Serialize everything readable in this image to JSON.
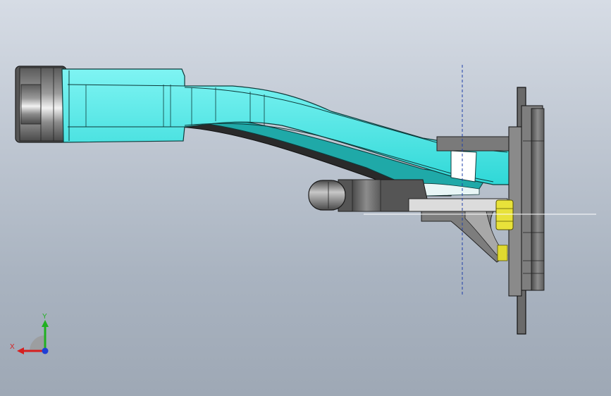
{
  "viewport": {
    "background_top": "#d6dce5",
    "background_bottom": "#9ea8b5"
  },
  "model": {
    "arm_color": "#2fe0df",
    "arm_dark": "#1a8f8e",
    "housing_color": "#6e6e6e",
    "housing_dark": "#3c3c3c",
    "nut_color": "#e8e23a",
    "centerline_color": "#1f3fa8"
  },
  "triad": {
    "x_label": "X",
    "y_label": "Y",
    "x_color": "#d62020",
    "y_color": "#20b020",
    "z_color": "#1f3fd6",
    "icon": "coordinate-triad-icon"
  }
}
